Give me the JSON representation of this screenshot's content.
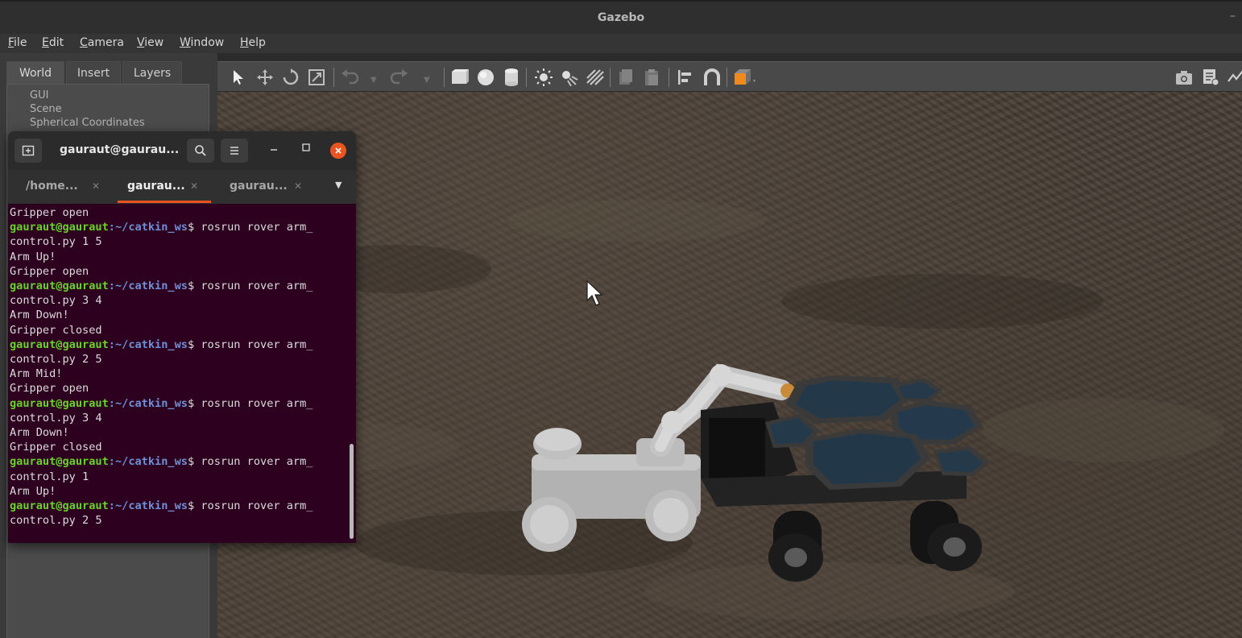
{
  "window": {
    "title": "Gazebo",
    "minimize_glyph": "–"
  },
  "menu": [
    "File",
    "Edit",
    "Camera",
    "View",
    "Window",
    "Help"
  ],
  "left_panel": {
    "tabs": [
      {
        "label": "World",
        "active": true
      },
      {
        "label": "Insert",
        "active": false
      },
      {
        "label": "Layers",
        "active": false
      }
    ],
    "world_items": [
      "GUI",
      "Scene",
      "Spherical Coordinates"
    ]
  },
  "toolbar": {
    "icons": [
      "select-arrow-icon",
      "translate-icon",
      "rotate-icon",
      "scale-icon",
      "undo-icon",
      "undo-dropdown-icon",
      "redo-icon",
      "redo-dropdown-icon",
      "box-shape-icon",
      "sphere-shape-icon",
      "cylinder-shape-icon",
      "point-light-icon",
      "spot-light-icon",
      "directional-light-icon",
      "copy-icon",
      "paste-icon",
      "align-icon",
      "snap-icon",
      "view-angle-icon",
      "screenshot-icon",
      "log-icon",
      "plot-icon"
    ]
  },
  "terminal": {
    "title": "gauraut@gaurau...",
    "tabs": [
      {
        "label": "/home...",
        "active": false
      },
      {
        "label": "gaurau...",
        "active": true
      },
      {
        "label": "gaurau...",
        "active": false
      }
    ],
    "user": "gauraut@gauraut",
    "path": ":~/catkin_ws",
    "lines": [
      {
        "type": "out",
        "text": "Gripper open"
      },
      {
        "type": "cmd",
        "text": "$ rosrun rover arm_"
      },
      {
        "type": "out",
        "text": "control.py 1 5"
      },
      {
        "type": "out",
        "text": "Arm Up!"
      },
      {
        "type": "out",
        "text": "Gripper open"
      },
      {
        "type": "cmd",
        "text": "$ rosrun rover arm_"
      },
      {
        "type": "out",
        "text": "control.py 3 4"
      },
      {
        "type": "out",
        "text": "Arm Down!"
      },
      {
        "type": "out",
        "text": "Gripper closed"
      },
      {
        "type": "cmd",
        "text": "$ rosrun rover arm_"
      },
      {
        "type": "out",
        "text": "control.py 2 5"
      },
      {
        "type": "out",
        "text": "Arm Mid!"
      },
      {
        "type": "out",
        "text": "Gripper open"
      },
      {
        "type": "cmd",
        "text": "$ rosrun rover arm_"
      },
      {
        "type": "out",
        "text": "control.py 3 4"
      },
      {
        "type": "out",
        "text": "Arm Down!"
      },
      {
        "type": "out",
        "text": "Gripper closed"
      },
      {
        "type": "cmd",
        "text": "$ rosrun rover arm_"
      },
      {
        "type": "out",
        "text": "control.py 1"
      },
      {
        "type": "out",
        "text": "Arm Up!"
      },
      {
        "type": "cmd",
        "text": "$ rosrun rover arm_"
      },
      {
        "type": "out",
        "text": "control.py 2 5"
      }
    ]
  },
  "colors": {
    "terminal_bg": "#2c001e",
    "prompt_user": "#6bd12b",
    "prompt_path": "#6f8fd6",
    "accent": "#e95420"
  }
}
